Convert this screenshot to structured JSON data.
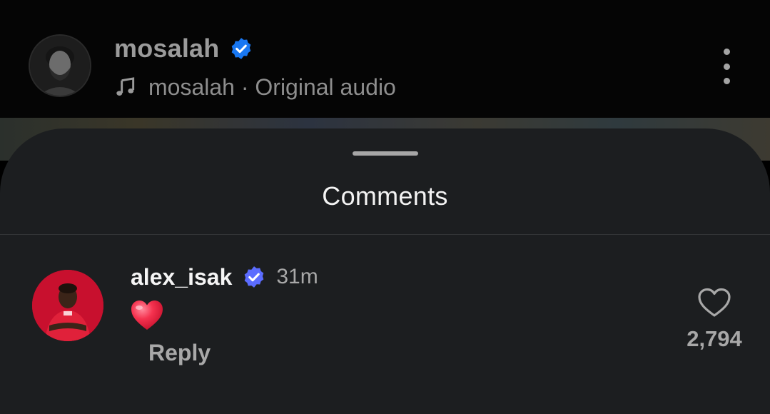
{
  "header": {
    "username": "mosalah",
    "audio_label": "mosalah · Original audio",
    "verified_color": "#1877f2"
  },
  "sheet": {
    "title": "Comments"
  },
  "comment": {
    "username": "alex_isak",
    "time": "31m",
    "emoji": "heart-emoji",
    "reply_label": "Reply",
    "like_count": "2,794",
    "verified_color": "#5b6cff"
  },
  "colors": {
    "sheet_bg": "#1c1e20",
    "top_bg": "#050505",
    "avatar_red": "#c8102e"
  }
}
